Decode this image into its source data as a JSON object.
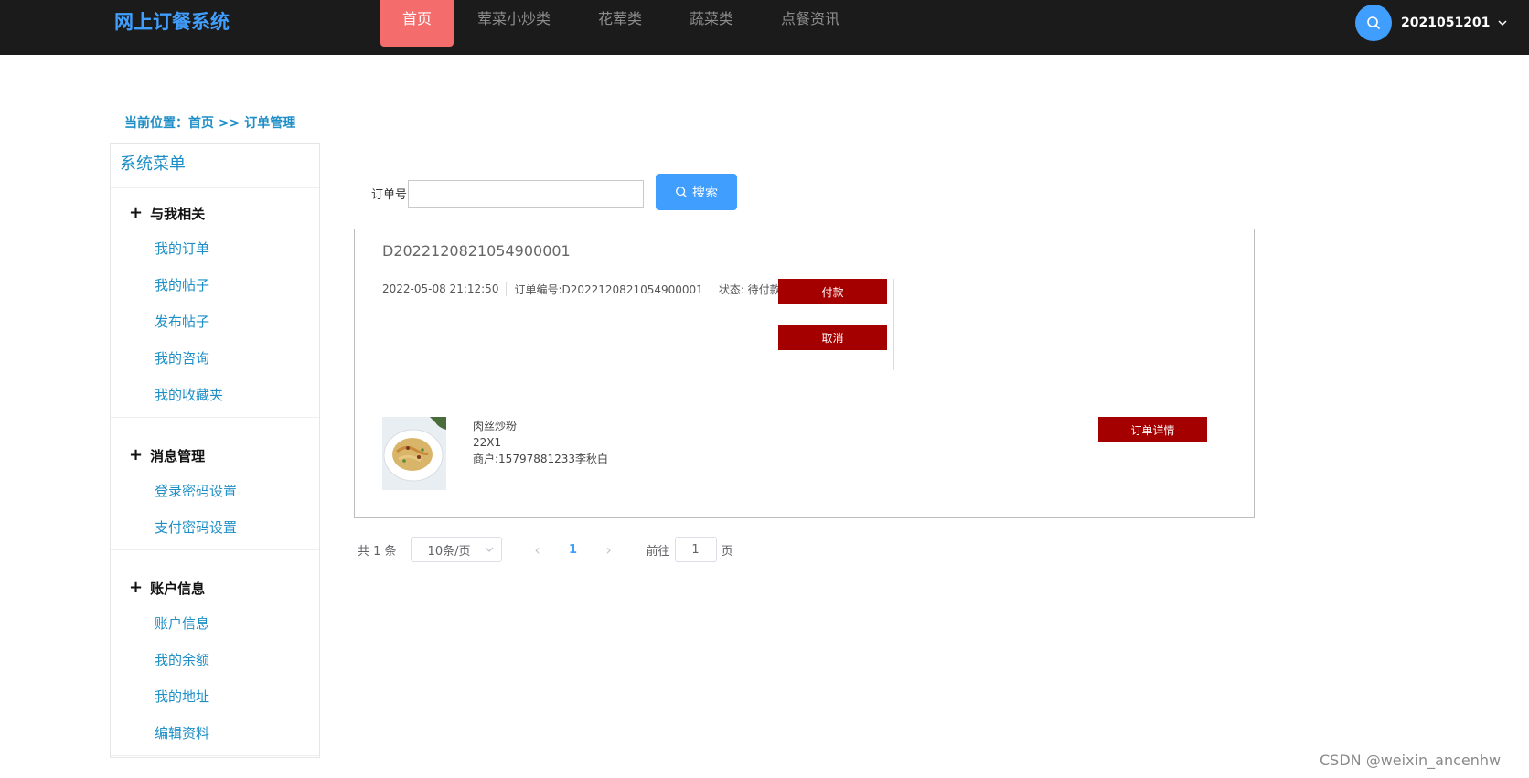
{
  "header": {
    "brand": "网上订餐系统",
    "nav": [
      {
        "label": "首页",
        "active": true
      },
      {
        "label": "荤菜小炒类",
        "active": false
      },
      {
        "label": "花荤类",
        "active": false
      },
      {
        "label": "蔬菜类",
        "active": false
      },
      {
        "label": "点餐资讯",
        "active": false
      }
    ],
    "username": "2021051201",
    "accent": "#f56c6c"
  },
  "breadcrumb": "当前位置：首页 >> 订单管理",
  "sidebar": {
    "title": "系统菜单",
    "groups": [
      {
        "title": "与我相关",
        "items": [
          "我的订单",
          "我的帖子",
          "发布帖子",
          "我的咨询",
          "我的收藏夹"
        ]
      },
      {
        "title": "消息管理",
        "items": [
          "登录密码设置",
          "支付密码设置"
        ]
      },
      {
        "title": "账户信息",
        "items": [
          "账户信息",
          "我的余额",
          "我的地址",
          "编辑资料"
        ]
      }
    ]
  },
  "search": {
    "label": "订单号",
    "value": "",
    "button_label": "搜索"
  },
  "order": {
    "id": "D2022120821054900001",
    "time": "2022-05-08 21:12:50",
    "order_no": "订单编号:D2022120821054900001",
    "status": "状态: 待付款",
    "pay_label": "付款",
    "cancel_label": "取消",
    "item": {
      "name": "肉丝炒粉",
      "qty": "22X1",
      "merchant": "商户:15797881233李秋白"
    },
    "detail_label": "订单详情"
  },
  "pagination": {
    "total": "共 1 条",
    "page_size": "10条/页",
    "current_page": "1",
    "goto_prefix": "前往",
    "goto_value": "1",
    "goto_suffix": "页"
  },
  "watermark": "CSDN @weixin_ancenhw",
  "colors": {
    "topbar": "#1b1b1b",
    "primary": "#409eff",
    "link": "#1e8fc6",
    "danger": "#a50000"
  }
}
